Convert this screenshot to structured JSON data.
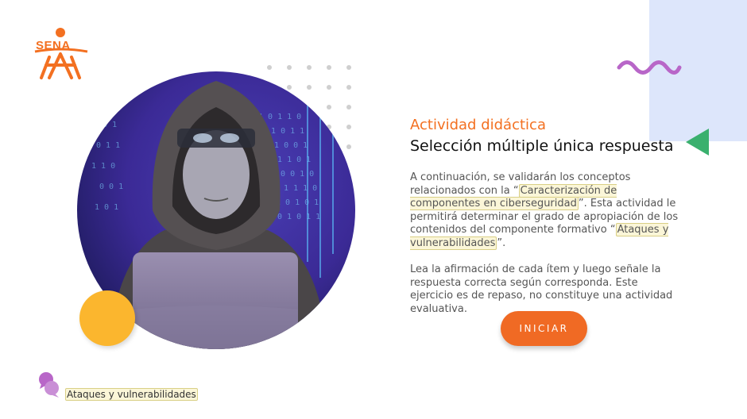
{
  "brand": {
    "logo_text": "SENA",
    "color": "#f37021"
  },
  "activity": {
    "title": "Actividad didáctica",
    "subtitle": "Selección múltiple única respuesta"
  },
  "paragraph1": {
    "part1": "A continuación, se validarán los conceptos relacionados con la “",
    "highlight1": "Caracterización de componentes en ciberseguridad",
    "part2": "”.  Esta actividad le permitirá determinar el grado de apropiación de los contenidos del componente formativo “",
    "highlight2": "Ataques y vulnerabilidades",
    "part3": "”."
  },
  "paragraph2": "Lea la afirmación de cada ítem y luego señale la respuesta correcta según corresponda.  Este ejercicio es de repaso, no constituye una actividad evaluativa.",
  "start_button": "INICIAR",
  "footer": {
    "label": "Ataques y vulnerabilidades"
  },
  "colors": {
    "accent_orange": "#f06a24",
    "panel_blue": "#dde6fb",
    "triangle_green": "#3ab06e",
    "wave_purple": "#b866c8",
    "yellow": "#fbb62e"
  },
  "icons": [
    "sena-logo",
    "wave-icon",
    "triangle-icon",
    "chat-bubbles-icon"
  ]
}
